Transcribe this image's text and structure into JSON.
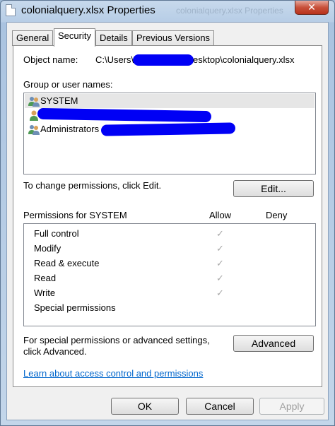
{
  "window": {
    "title": "colonialquery.xlsx Properties",
    "ghost_title": "colonialquery.xlsx Properties",
    "close_glyph": "✕"
  },
  "tabs": [
    {
      "label": "General"
    },
    {
      "label": "Security"
    },
    {
      "label": "Details"
    },
    {
      "label": "Previous Versions"
    }
  ],
  "object": {
    "label": "Object name:",
    "path_prefix": "C:\\Users\\",
    "path_suffix": "esktop\\colonialquery.xlsx"
  },
  "groups": {
    "label": "Group or user names:",
    "items": [
      {
        "name": "SYSTEM",
        "icon": "group-icon"
      },
      {
        "name": "",
        "icon": "user-icon"
      },
      {
        "name": "Administrators",
        "icon": "group-icon"
      }
    ]
  },
  "change_hint": "To change permissions, click Edit.",
  "edit_button": "Edit...",
  "permissions": {
    "label": "Permissions for SYSTEM",
    "allow_header": "Allow",
    "deny_header": "Deny",
    "rows": [
      {
        "name": "Full control",
        "allow": "✓",
        "deny": ""
      },
      {
        "name": "Modify",
        "allow": "✓",
        "deny": ""
      },
      {
        "name": "Read & execute",
        "allow": "✓",
        "deny": ""
      },
      {
        "name": "Read",
        "allow": "✓",
        "deny": ""
      },
      {
        "name": "Write",
        "allow": "✓",
        "deny": ""
      },
      {
        "name": "Special permissions",
        "allow": "",
        "deny": ""
      }
    ]
  },
  "advanced": {
    "hint_line1": "For special permissions or advanced settings,",
    "hint_line2": "click Advanced.",
    "button": "Advanced"
  },
  "learn_link": "Learn about access control and permissions",
  "footer": {
    "ok": "OK",
    "cancel": "Cancel",
    "apply": "Apply"
  },
  "colors": {
    "redaction": "#0000f5",
    "link": "#0066cc",
    "selected_row": "#e6e6e6"
  }
}
